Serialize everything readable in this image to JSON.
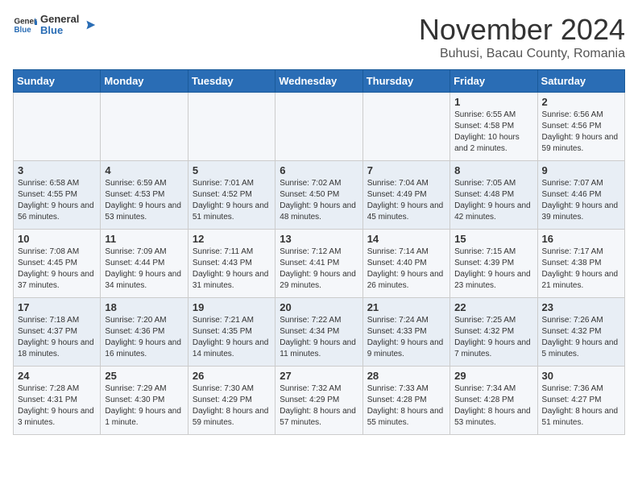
{
  "header": {
    "logo_general": "General",
    "logo_blue": "Blue",
    "month_title": "November 2024",
    "location": "Buhusi, Bacau County, Romania"
  },
  "calendar": {
    "days_of_week": [
      "Sunday",
      "Monday",
      "Tuesday",
      "Wednesday",
      "Thursday",
      "Friday",
      "Saturday"
    ],
    "weeks": [
      [
        {
          "day": "",
          "sunrise": "",
          "sunset": "",
          "daylight": ""
        },
        {
          "day": "",
          "sunrise": "",
          "sunset": "",
          "daylight": ""
        },
        {
          "day": "",
          "sunrise": "",
          "sunset": "",
          "daylight": ""
        },
        {
          "day": "",
          "sunrise": "",
          "sunset": "",
          "daylight": ""
        },
        {
          "day": "",
          "sunrise": "",
          "sunset": "",
          "daylight": ""
        },
        {
          "day": "1",
          "sunrise": "Sunrise: 6:55 AM",
          "sunset": "Sunset: 4:58 PM",
          "daylight": "Daylight: 10 hours and 2 minutes."
        },
        {
          "day": "2",
          "sunrise": "Sunrise: 6:56 AM",
          "sunset": "Sunset: 4:56 PM",
          "daylight": "Daylight: 9 hours and 59 minutes."
        }
      ],
      [
        {
          "day": "3",
          "sunrise": "Sunrise: 6:58 AM",
          "sunset": "Sunset: 4:55 PM",
          "daylight": "Daylight: 9 hours and 56 minutes."
        },
        {
          "day": "4",
          "sunrise": "Sunrise: 6:59 AM",
          "sunset": "Sunset: 4:53 PM",
          "daylight": "Daylight: 9 hours and 53 minutes."
        },
        {
          "day": "5",
          "sunrise": "Sunrise: 7:01 AM",
          "sunset": "Sunset: 4:52 PM",
          "daylight": "Daylight: 9 hours and 51 minutes."
        },
        {
          "day": "6",
          "sunrise": "Sunrise: 7:02 AM",
          "sunset": "Sunset: 4:50 PM",
          "daylight": "Daylight: 9 hours and 48 minutes."
        },
        {
          "day": "7",
          "sunrise": "Sunrise: 7:04 AM",
          "sunset": "Sunset: 4:49 PM",
          "daylight": "Daylight: 9 hours and 45 minutes."
        },
        {
          "day": "8",
          "sunrise": "Sunrise: 7:05 AM",
          "sunset": "Sunset: 4:48 PM",
          "daylight": "Daylight: 9 hours and 42 minutes."
        },
        {
          "day": "9",
          "sunrise": "Sunrise: 7:07 AM",
          "sunset": "Sunset: 4:46 PM",
          "daylight": "Daylight: 9 hours and 39 minutes."
        }
      ],
      [
        {
          "day": "10",
          "sunrise": "Sunrise: 7:08 AM",
          "sunset": "Sunset: 4:45 PM",
          "daylight": "Daylight: 9 hours and 37 minutes."
        },
        {
          "day": "11",
          "sunrise": "Sunrise: 7:09 AM",
          "sunset": "Sunset: 4:44 PM",
          "daylight": "Daylight: 9 hours and 34 minutes."
        },
        {
          "day": "12",
          "sunrise": "Sunrise: 7:11 AM",
          "sunset": "Sunset: 4:43 PM",
          "daylight": "Daylight: 9 hours and 31 minutes."
        },
        {
          "day": "13",
          "sunrise": "Sunrise: 7:12 AM",
          "sunset": "Sunset: 4:41 PM",
          "daylight": "Daylight: 9 hours and 29 minutes."
        },
        {
          "day": "14",
          "sunrise": "Sunrise: 7:14 AM",
          "sunset": "Sunset: 4:40 PM",
          "daylight": "Daylight: 9 hours and 26 minutes."
        },
        {
          "day": "15",
          "sunrise": "Sunrise: 7:15 AM",
          "sunset": "Sunset: 4:39 PM",
          "daylight": "Daylight: 9 hours and 23 minutes."
        },
        {
          "day": "16",
          "sunrise": "Sunrise: 7:17 AM",
          "sunset": "Sunset: 4:38 PM",
          "daylight": "Daylight: 9 hours and 21 minutes."
        }
      ],
      [
        {
          "day": "17",
          "sunrise": "Sunrise: 7:18 AM",
          "sunset": "Sunset: 4:37 PM",
          "daylight": "Daylight: 9 hours and 18 minutes."
        },
        {
          "day": "18",
          "sunrise": "Sunrise: 7:20 AM",
          "sunset": "Sunset: 4:36 PM",
          "daylight": "Daylight: 9 hours and 16 minutes."
        },
        {
          "day": "19",
          "sunrise": "Sunrise: 7:21 AM",
          "sunset": "Sunset: 4:35 PM",
          "daylight": "Daylight: 9 hours and 14 minutes."
        },
        {
          "day": "20",
          "sunrise": "Sunrise: 7:22 AM",
          "sunset": "Sunset: 4:34 PM",
          "daylight": "Daylight: 9 hours and 11 minutes."
        },
        {
          "day": "21",
          "sunrise": "Sunrise: 7:24 AM",
          "sunset": "Sunset: 4:33 PM",
          "daylight": "Daylight: 9 hours and 9 minutes."
        },
        {
          "day": "22",
          "sunrise": "Sunrise: 7:25 AM",
          "sunset": "Sunset: 4:32 PM",
          "daylight": "Daylight: 9 hours and 7 minutes."
        },
        {
          "day": "23",
          "sunrise": "Sunrise: 7:26 AM",
          "sunset": "Sunset: 4:32 PM",
          "daylight": "Daylight: 9 hours and 5 minutes."
        }
      ],
      [
        {
          "day": "24",
          "sunrise": "Sunrise: 7:28 AM",
          "sunset": "Sunset: 4:31 PM",
          "daylight": "Daylight: 9 hours and 3 minutes."
        },
        {
          "day": "25",
          "sunrise": "Sunrise: 7:29 AM",
          "sunset": "Sunset: 4:30 PM",
          "daylight": "Daylight: 9 hours and 1 minute."
        },
        {
          "day": "26",
          "sunrise": "Sunrise: 7:30 AM",
          "sunset": "Sunset: 4:29 PM",
          "daylight": "Daylight: 8 hours and 59 minutes."
        },
        {
          "day": "27",
          "sunrise": "Sunrise: 7:32 AM",
          "sunset": "Sunset: 4:29 PM",
          "daylight": "Daylight: 8 hours and 57 minutes."
        },
        {
          "day": "28",
          "sunrise": "Sunrise: 7:33 AM",
          "sunset": "Sunset: 4:28 PM",
          "daylight": "Daylight: 8 hours and 55 minutes."
        },
        {
          "day": "29",
          "sunrise": "Sunrise: 7:34 AM",
          "sunset": "Sunset: 4:28 PM",
          "daylight": "Daylight: 8 hours and 53 minutes."
        },
        {
          "day": "30",
          "sunrise": "Sunrise: 7:36 AM",
          "sunset": "Sunset: 4:27 PM",
          "daylight": "Daylight: 8 hours and 51 minutes."
        }
      ]
    ]
  }
}
